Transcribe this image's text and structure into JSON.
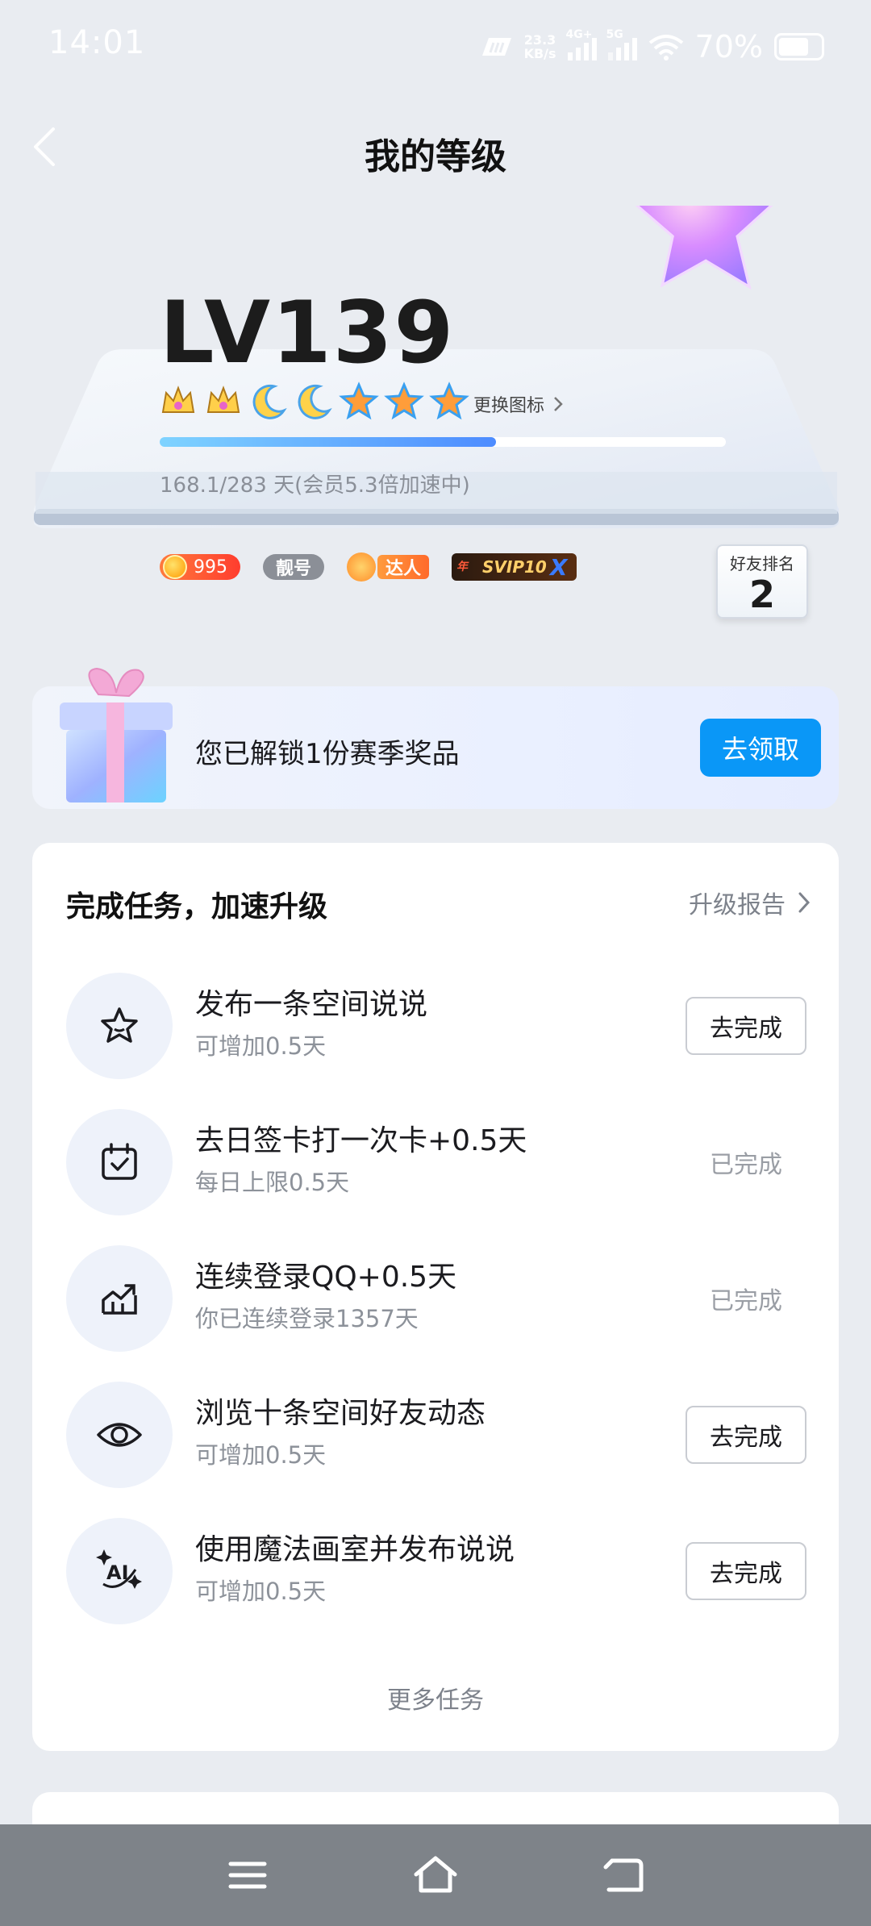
{
  "status_bar": {
    "time": "14:01",
    "net_speed": "23.3",
    "net_unit": "KB/s",
    "net1": "4G+",
    "net2": "5G",
    "battery": "70%"
  },
  "header": {
    "title": "我的等级"
  },
  "level_card": {
    "level": "LV139",
    "icons": [
      "crown-icon",
      "crown-icon",
      "moon-icon",
      "moon-icon",
      "star-icon",
      "star-icon",
      "star-icon"
    ],
    "change_icon_label": "更换图标",
    "progress_fraction": 0.594,
    "progress_text": "168.1/283 天(会员5.3倍加速中)",
    "badges": {
      "coin_value": "995",
      "pretty_number": "靓号",
      "daren": "达人",
      "svip_year": "年",
      "svip": "SVIP10"
    },
    "rank_label": "好友排名",
    "rank_value": "2"
  },
  "reward": {
    "text": "您已解锁1份赛季奖品",
    "button": "去领取"
  },
  "tasks": {
    "title": "完成任务，加速升级",
    "report_label": "升级报告",
    "items": [
      {
        "icon": "star-outline-icon",
        "name": "发布一条空间说说",
        "sub": "可增加0.5天",
        "action": "去完成",
        "done": false
      },
      {
        "icon": "calendar-check-icon",
        "name": "去日签卡打一次卡+0.5天",
        "sub": "每日上限0.5天",
        "action": "已完成",
        "done": true
      },
      {
        "icon": "chart-up-icon",
        "name": "连续登录QQ+0.5天",
        "sub": "你已连续登录1357天",
        "action": "已完成",
        "done": true
      },
      {
        "icon": "eye-icon",
        "name": "浏览十条空间好友动态",
        "sub": "可增加0.5天",
        "action": "去完成",
        "done": false
      },
      {
        "icon": "ai-sparkle-icon",
        "name": "使用魔法画室并发布说说",
        "sub": "可增加0.5天",
        "action": "去完成",
        "done": false
      }
    ],
    "more": "更多任务"
  },
  "colors": {
    "accent": "#0a97f7",
    "background": "#e9ecf1",
    "nav_bar": "#7e8389"
  }
}
